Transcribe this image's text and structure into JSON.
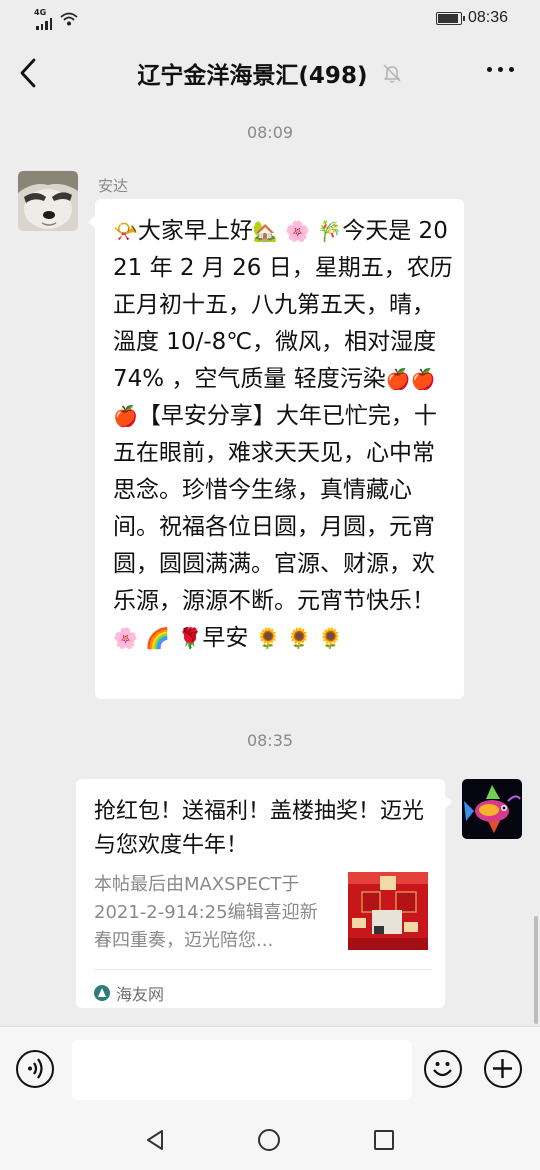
{
  "status_bar": {
    "network_label": "4G",
    "time": "08:36",
    "battery_level": 0.9,
    "icons": [
      "signal-icon",
      "wifi-icon",
      "battery-icon"
    ]
  },
  "header": {
    "title": "辽宁金洋海景汇(498)",
    "icons": [
      "back-icon",
      "mute-icon",
      "more-icon"
    ]
  },
  "chat": {
    "timestamp_1": "08:09",
    "message_1": {
      "sender": "安达",
      "text_parts": [
        {
          "emoji": "📯"
        },
        {
          "text": "大家早上好"
        },
        {
          "emoji": "🏡"
        },
        {
          "text": " "
        },
        {
          "emoji": "🌸"
        },
        {
          "text": " "
        },
        {
          "emoji": "🎋"
        },
        {
          "text": "今天是 2021 年 2 月 26 日，星期五，农历正月初十五，八九第五天，晴，溫度 10/-8℃，微风，相对湿度 74% ，空气质量  轻度污染"
        },
        {
          "emoji": "🍎🍎🍎"
        },
        {
          "text": "【早安分享】大年已忙完，十五在眼前，难求天天见，心中常思念。珍惜今生缘，真情藏心间。祝福各位日圆，月圆，元宵圆，圆圆满满。官源、财源，欢乐源，源源不断。元宵节快乐！ "
        },
        {
          "emoji": "🌸"
        },
        {
          "text": " "
        },
        {
          "emoji": "🌈"
        },
        {
          "text": " "
        },
        {
          "emoji": "🌹"
        },
        {
          "text": "早安 "
        },
        {
          "emoji": "🌻 🌻 🌻"
        }
      ]
    },
    "timestamp_2": "08:35",
    "message_2": {
      "card_title": "抢红包！送福利！盖楼抽奖！迈光与您欢度牛年！",
      "card_desc": "本帖最后由MAXSPECT于2021-2-914:25编辑喜迎新春四重奏，迈光陪您...",
      "card_source": "海友网"
    }
  },
  "input_bar": {
    "placeholder": "",
    "icons": [
      "voice-icon",
      "emoji-icon",
      "plus-icon"
    ]
  },
  "nav_bar": {
    "icons": [
      "nav-back-icon",
      "nav-home-icon",
      "nav-recent-icon"
    ]
  }
}
